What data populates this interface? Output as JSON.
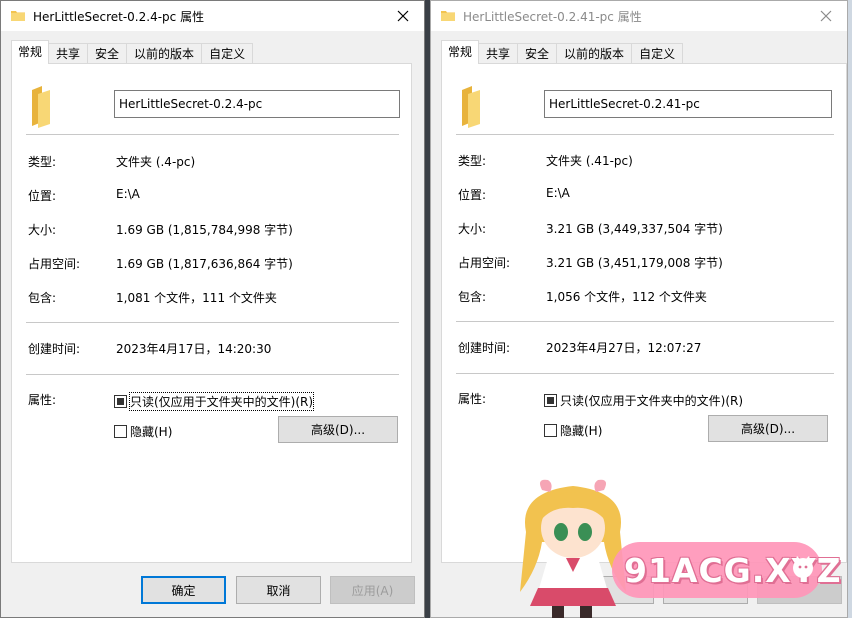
{
  "left": {
    "title": "HerLittleSecret-0.2.4-pc 属性",
    "tabs": [
      "常规",
      "共享",
      "安全",
      "以前的版本",
      "自定义"
    ],
    "active_tab": "常规",
    "name_value": "HerLittleSecret-0.2.4-pc",
    "props": {
      "type_label": "类型:",
      "type_value": "文件夹 (.4-pc)",
      "location_label": "位置:",
      "location_value": "E:\\A",
      "size_label": "大小:",
      "size_value": "1.69 GB (1,815,784,998 字节)",
      "disk_label": "占用空间:",
      "disk_value": "1.69 GB (1,817,636,864 字节)",
      "contains_label": "包含:",
      "contains_value": "1,081 个文件，111 个文件夹",
      "created_label": "创建时间:",
      "created_value": "2023年4月17日，14:20:30",
      "attributes_label": "属性:"
    },
    "readonly_label": "只读(仅应用于文件夹中的文件)(R)",
    "hidden_label": "隐藏(H)",
    "advanced_label": "高级(D)...",
    "footer": {
      "ok": "确定",
      "cancel": "取消",
      "apply": "应用(A)"
    }
  },
  "right": {
    "title": "HerLittleSecret-0.2.41-pc 属性",
    "tabs": [
      "常规",
      "共享",
      "安全",
      "以前的版本",
      "自定义"
    ],
    "active_tab": "常规",
    "name_value": "HerLittleSecret-0.2.41-pc",
    "props": {
      "type_label": "类型:",
      "type_value": "文件夹 (.41-pc)",
      "location_label": "位置:",
      "location_value": "E:\\A",
      "size_label": "大小:",
      "size_value": "3.21 GB (3,449,337,504 字节)",
      "disk_label": "占用空间:",
      "disk_value": "3.21 GB (3,451,179,008 字节)",
      "contains_label": "包含:",
      "contains_value": "1,056 个文件，112 个文件夹",
      "created_label": "创建时间:",
      "created_value": "2023年4月27日，12:07:27",
      "attributes_label": "属性:"
    },
    "readonly_label": "只读(仅应用于文件夹中的文件)(R)",
    "hidden_label": "隐藏(H)",
    "advanced_label": "高级(D)..."
  },
  "watermark": "91ACG.XYZ",
  "colors": {
    "folder": "#f3c44f",
    "accent": "#0078d7",
    "watermark_pink": "#ff96b9"
  },
  "icons": [
    "folder-icon",
    "close-icon",
    "cat-icon"
  ]
}
